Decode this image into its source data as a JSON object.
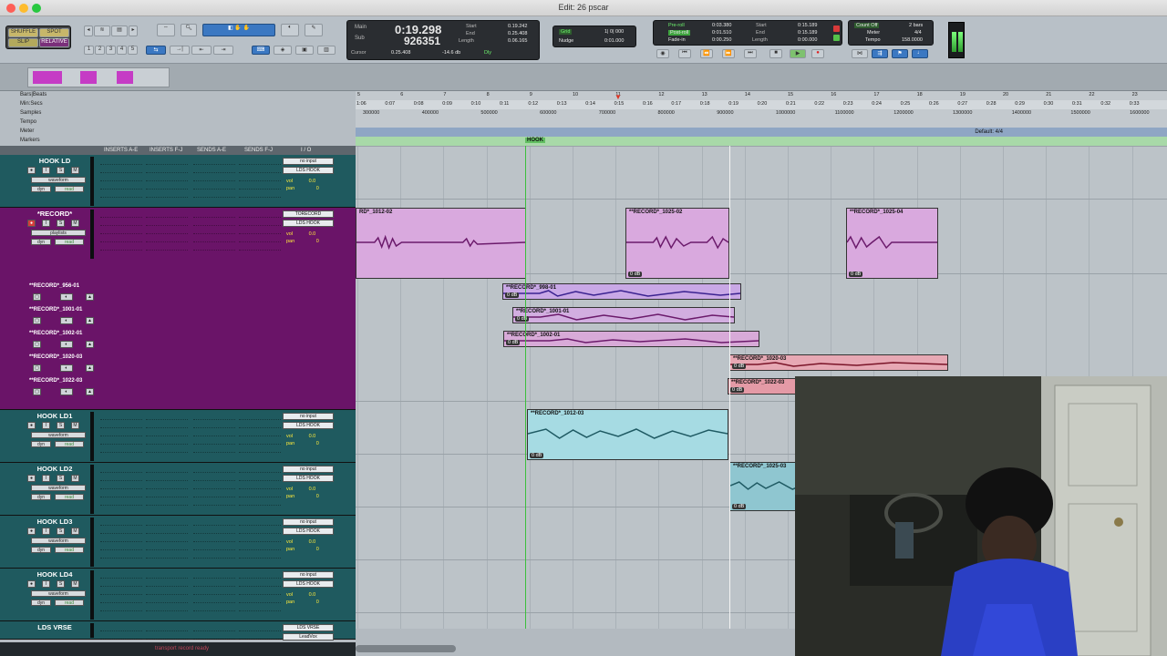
{
  "window": {
    "title": "Edit: 26 pscar"
  },
  "modes": {
    "shuffle": "SHUFFLE",
    "spot": "SPOT",
    "slip": "SLIP",
    "grid": "RELATIVE"
  },
  "zoom_presets": [
    "1",
    "2",
    "3",
    "4",
    "5"
  ],
  "counters": {
    "main_label": "Main",
    "main_value": "0:19.298",
    "sub_label": "Sub",
    "sub_value": "926351",
    "cursor_label": "Cursor",
    "cursor_value": "0.25.408",
    "cursor_db": "-14.6 db",
    "start_label": "Start",
    "start_value": "0.19.242",
    "end_label": "End",
    "end_value": "0.25.408",
    "length_label": "Length",
    "length_value": "0.06.165",
    "dly": "Dly"
  },
  "grid_nudge": {
    "grid_label": "Grid",
    "grid_value": "1| 0| 000",
    "nudge_label": "Nudge",
    "nudge_value": "0:01.000"
  },
  "transport": {
    "preroll": "Pre-roll",
    "preroll_value": "0:03.380",
    "postroll": "Post-roll",
    "postroll_value": "0:01.510",
    "fadein": "Fade-in",
    "fadein_value": "0:00.250",
    "start": "Start",
    "start_value": "0:15.189",
    "end": "End",
    "end_value": "0:15.189",
    "length": "Length",
    "length_value": "0:00.000"
  },
  "meter": {
    "countoff": "Count Off",
    "countoff_value": "2 bars",
    "meter_label": "Meter",
    "meter_value": "4/4",
    "tempo_label": "Tempo",
    "tempo_value": "158.0000"
  },
  "rulers": {
    "labels": [
      "Bars|Beats",
      "Min:Secs",
      "Samples",
      "Tempo",
      "Meter",
      "Markers"
    ],
    "bars": [
      "5",
      "6",
      "7",
      "8",
      "9",
      "10",
      "11",
      "12",
      "13",
      "14",
      "15",
      "16",
      "17",
      "18",
      "19",
      "20",
      "21",
      "22",
      "23"
    ],
    "mins": [
      "1:06",
      "0:07",
      "0:08",
      "0:09",
      "0:10",
      "0:11",
      "0:12",
      "0:13",
      "0:14",
      "0:15",
      "0:16",
      "0:17",
      "0:18",
      "0:19",
      "0:20",
      "0:21",
      "0:22",
      "0:23",
      "0:24",
      "0:25",
      "0:26",
      "0:27",
      "0:28",
      "0:29",
      "0:30",
      "0:31",
      "0:32",
      "0:33"
    ],
    "samples": [
      "300000",
      "400000",
      "500000",
      "600000",
      "700000",
      "800000",
      "900000",
      "1000000",
      "1100000",
      "1200000",
      "1300000",
      "1400000",
      "1500000",
      "1600000"
    ],
    "default_meter": "Default: 4/4",
    "marker": "HOOK"
  },
  "columns": {
    "inserts_ae": "INSERTS A-E",
    "inserts_fj": "INSERTS F-J",
    "sends_ae": "SENDS A-E",
    "sends_fj": "SENDS F-J",
    "io": "I / O"
  },
  "tracks": [
    {
      "name": "HOOK LD",
      "view": "waveform",
      "auto": "dyn",
      "mode": "read",
      "input": "no input",
      "output": "LDS HOOK",
      "vol": "0.0",
      "pan": "0"
    },
    {
      "name": "*RECORD*",
      "view": "playlists",
      "auto": "dyn",
      "mode": "read",
      "input": "TORECORD",
      "output": "LDS HOOK",
      "vol": "0.0",
      "pan": "0"
    },
    {
      "name": "HOOK LD1",
      "view": "waveform",
      "auto": "dyn",
      "mode": "read",
      "input": "no input",
      "output": "LDS HOOK",
      "vol": "0.0",
      "pan": "0"
    },
    {
      "name": "HOOK LD2",
      "view": "waveform",
      "auto": "dyn",
      "mode": "read",
      "input": "no input",
      "output": "LDS HOOK",
      "vol": "0.0",
      "pan": "0"
    },
    {
      "name": "HOOK LD3",
      "view": "waveform",
      "auto": "dyn",
      "mode": "read",
      "input": "no input",
      "output": "LDS HOOK",
      "vol": "0.0",
      "pan": "0"
    },
    {
      "name": "HOOK LD4",
      "view": "waveform",
      "auto": "dyn",
      "mode": "read",
      "input": "no input",
      "output": "LDS HOOK",
      "vol": "0.0",
      "pan": "0"
    },
    {
      "name": "LDS VRSE",
      "view": "",
      "auto": "",
      "mode": "",
      "input": "LDS VRSE",
      "output": "LeadVox",
      "vol": "",
      "pan": ""
    }
  ],
  "playlists": [
    "**RECORD*_956-01",
    "**RECORD*_1001-01",
    "**RECORD*_1002-01",
    "**RECORD*_1020-03",
    "**RECORD*_1022-03"
  ],
  "clips": {
    "rec1": "RD*_1012-02",
    "rec2": "**RECORD*_1025-02",
    "rec3": "**RECORD*_1025-04",
    "alt1": "**RECORD*_998-01",
    "alt2": "**RECORD*_1001-01",
    "alt3": "**RECORD*_1002-01",
    "alt4": "**RECORD*_1020-03",
    "alt5": "**RECORD*_1022-03",
    "ld1": "**RECORD*_1012-03",
    "ld2": "**RECORD*_1025-03",
    "gain": "0 dB"
  },
  "status": "transport record ready"
}
